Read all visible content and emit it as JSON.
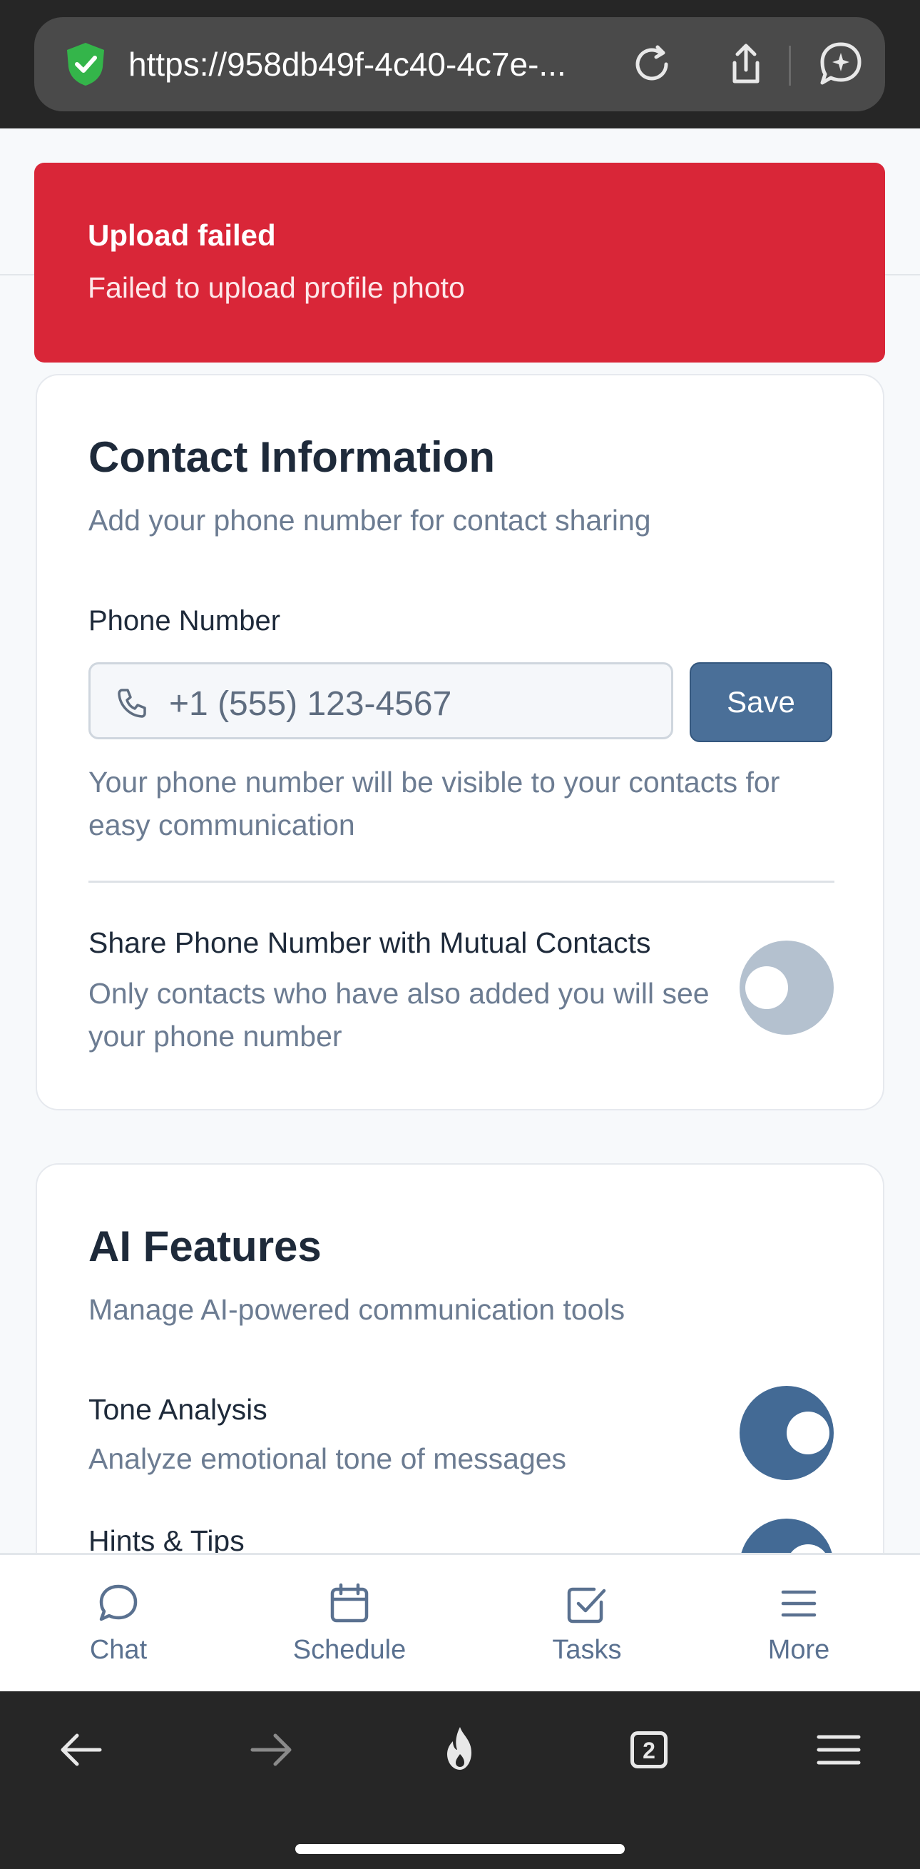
{
  "browser": {
    "url": "https://958db49f-4c40-4c7e-...",
    "tab_count": "2"
  },
  "toast": {
    "title": "Upload failed",
    "message": "Failed to upload profile photo",
    "color": "#d92638"
  },
  "contact_card": {
    "title": "Contact Information",
    "subtitle": "Add your phone number for contact sharing",
    "phone_label": "Phone Number",
    "phone_placeholder": "+1 (555) 123-4567",
    "save_label": "Save",
    "phone_hint": "Your phone number will be visible to your contacts for easy communication",
    "share_title": "Share Phone Number with Mutual Contacts",
    "share_desc": "Only contacts who have also added you will see your phone number",
    "share_enabled": false
  },
  "ai_card": {
    "title": "AI Features",
    "subtitle": "Manage AI-powered communication tools",
    "tone_title": "Tone Analysis",
    "tone_desc": "Analyze emotional tone of messages",
    "tone_enabled": true,
    "hints_title": "Hints & Tips",
    "hints_enabled": true
  },
  "nav": {
    "chat": "Chat",
    "schedule": "Schedule",
    "tasks": "Tasks",
    "more": "More"
  },
  "colors": {
    "accent": "#4a6f98",
    "toggle_on": "#436a95",
    "toggle_off": "#b4c1cf"
  }
}
